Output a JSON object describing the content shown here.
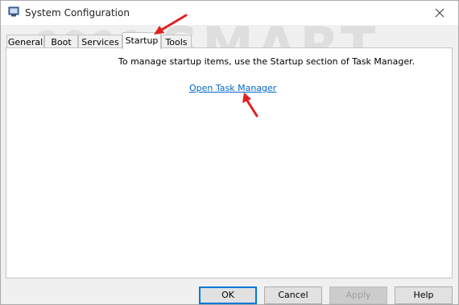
{
  "window": {
    "title": "System Configuration",
    "icon": "system-config-icon",
    "close_icon": "close-icon"
  },
  "tabs": [
    {
      "label": "General",
      "selected": false
    },
    {
      "label": "Boot",
      "selected": false
    },
    {
      "label": "Services",
      "selected": false
    },
    {
      "label": "Startup",
      "selected": true
    },
    {
      "label": "Tools",
      "selected": false
    }
  ],
  "startup_panel": {
    "message": "To manage startup items, use the Startup section of Task Manager.",
    "link_label": "Open Task Manager"
  },
  "buttons": {
    "ok": "OK",
    "cancel": "Cancel",
    "apply": "Apply",
    "help": "Help"
  },
  "watermark": {
    "line1": "SMART",
    "line2": "PCUSER"
  },
  "colors": {
    "link": "#0066cc",
    "annotation_arrow": "#e02020",
    "default_button_border": "#0078d7"
  }
}
